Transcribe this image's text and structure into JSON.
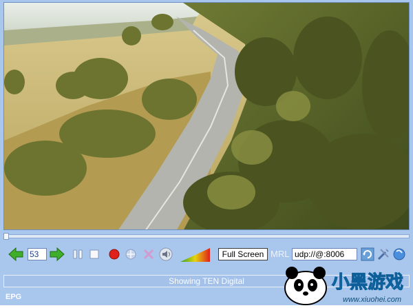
{
  "player": {
    "channel_number": "53",
    "fullscreen_label": "Full Screen",
    "mrl_label": "MRL",
    "mrl_value": "udp://@:8006",
    "status_text": "Showing TEN Digital",
    "epg_label": "EPG"
  },
  "icons": [
    "prev-channel-icon",
    "next-channel-icon",
    "pause-icon",
    "stop-icon",
    "record-icon",
    "snapshot-icon",
    "close-icon",
    "volume-icon",
    "volume-ramp-icon",
    "refresh-icon",
    "settings-icon",
    "info-icon"
  ],
  "watermark": {
    "brand_text": "小黑游戏",
    "url_text": "www.xiuohei.com"
  },
  "colors": {
    "frame_bg": "#a9c6ec",
    "accent_green": "#3fae2a",
    "record_red": "#e0201a"
  }
}
